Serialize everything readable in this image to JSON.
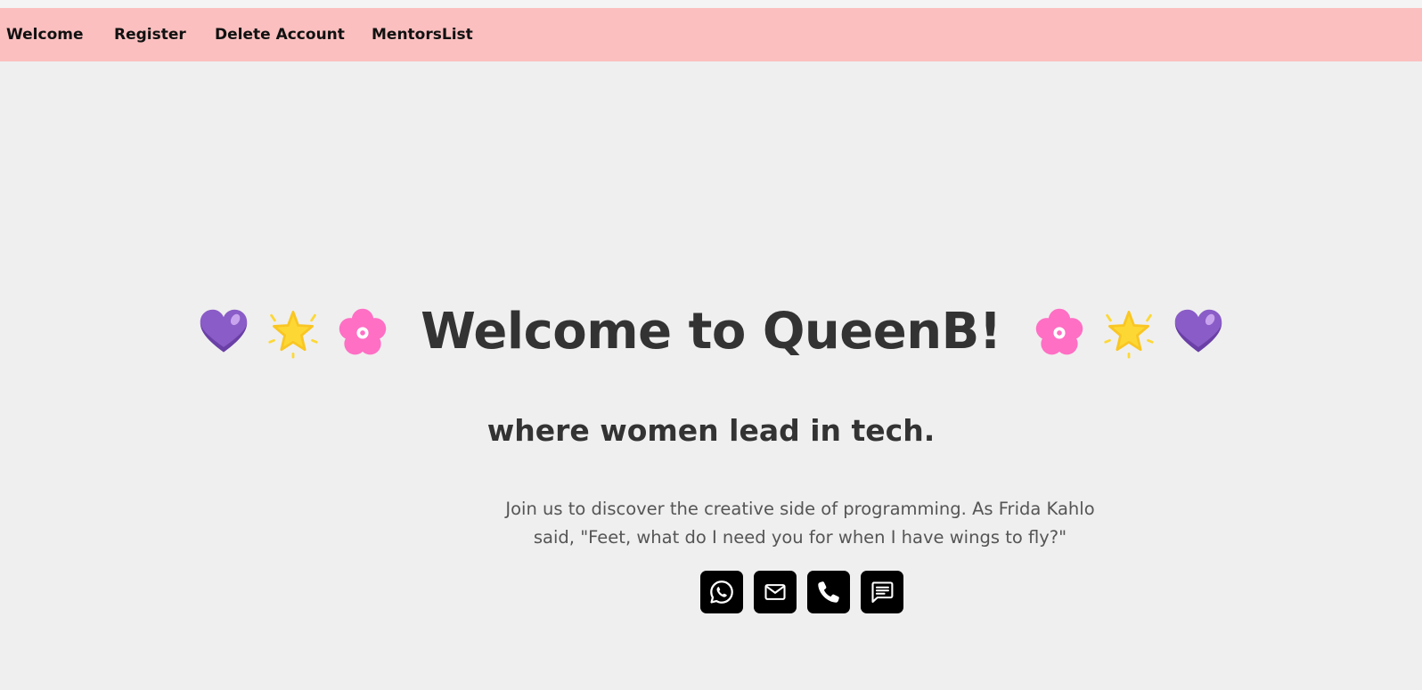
{
  "nav": {
    "items": [
      {
        "label": "Welcome"
      },
      {
        "label": "Register"
      },
      {
        "label": "Delete Account"
      },
      {
        "label": "MentorsList"
      }
    ]
  },
  "hero": {
    "title": "Welcome to QueenB!",
    "title_emojis_left": [
      "purple-heart-icon",
      "glowing-star-icon",
      "cherry-blossom-icon"
    ],
    "title_emojis_right": [
      "cherry-blossom-icon",
      "glowing-star-icon",
      "purple-heart-icon"
    ],
    "subtitle": "where women lead in tech.",
    "quote_line1": "Join us to discover the creative side of programming. As Frida Kahlo",
    "quote_line2": "said, \"Feet, what do I need you for when I have wings to fly?\""
  },
  "contact": {
    "buttons": [
      "whatsapp-icon",
      "email-icon",
      "phone-icon",
      "message-icon"
    ]
  },
  "colors": {
    "navbar_bg": "#fbbfbf",
    "page_bg": "#efefef",
    "heading": "#333333",
    "body_text": "#555555",
    "button_bg": "#000000"
  }
}
